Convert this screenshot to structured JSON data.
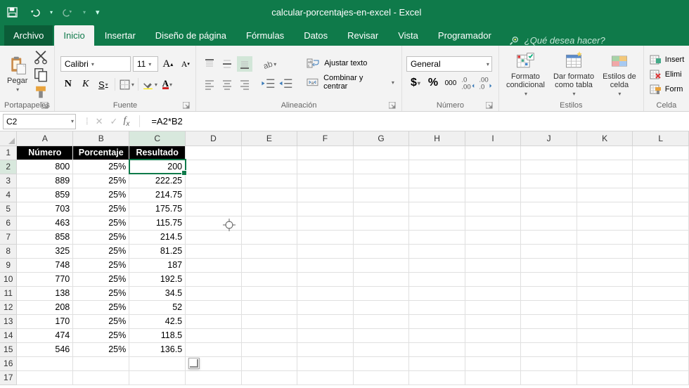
{
  "title_bar": {
    "document_title": "calcular-porcentajes-en-excel  -  Excel"
  },
  "tabs": {
    "file": "Archivo",
    "items": [
      "Inicio",
      "Insertar",
      "Diseño de página",
      "Fórmulas",
      "Datos",
      "Revisar",
      "Vista",
      "Programador"
    ],
    "active_index": 0,
    "tellme_placeholder": "¿Qué desea hacer?"
  },
  "ribbon": {
    "clipboard": {
      "label": "Portapapeles",
      "paste": "Pegar"
    },
    "font": {
      "label": "Fuente",
      "family": "Calibri",
      "size": "11",
      "bold": "N",
      "italic": "K",
      "underline": "S"
    },
    "alignment": {
      "label": "Alineación",
      "wrap": "Ajustar texto",
      "merge": "Combinar y centrar"
    },
    "number": {
      "label": "Número",
      "format": "General"
    },
    "styles": {
      "label": "Estilos",
      "conditional": "Formato\ncondicional",
      "as_table": "Dar formato\ncomo tabla",
      "cell_styles": "Estilos de\ncelda"
    },
    "cells": {
      "label": "Celda",
      "insert": "Insert",
      "delete": "Elimi",
      "format": "Form"
    }
  },
  "name_box": {
    "value": "C2"
  },
  "formula_bar": {
    "value": "=A2*B2"
  },
  "columns": [
    "A",
    "B",
    "C",
    "D",
    "E",
    "F",
    "G",
    "H",
    "I",
    "J",
    "K",
    "L"
  ],
  "active_cell": {
    "col": "C",
    "row": 2
  },
  "chart_data": {
    "type": "table",
    "headers": [
      "Número",
      "Porcentaje",
      "Resultado"
    ],
    "rows": [
      {
        "n": 1,
        "A": "Número",
        "B": "Porcentaje",
        "C": "Resultado",
        "header": true
      },
      {
        "n": 2,
        "A": "800",
        "B": "25%",
        "C": "200"
      },
      {
        "n": 3,
        "A": "889",
        "B": "25%",
        "C": "222.25"
      },
      {
        "n": 4,
        "A": "859",
        "B": "25%",
        "C": "214.75"
      },
      {
        "n": 5,
        "A": "703",
        "B": "25%",
        "C": "175.75"
      },
      {
        "n": 6,
        "A": "463",
        "B": "25%",
        "C": "115.75"
      },
      {
        "n": 7,
        "A": "858",
        "B": "25%",
        "C": "214.5"
      },
      {
        "n": 8,
        "A": "325",
        "B": "25%",
        "C": "81.25"
      },
      {
        "n": 9,
        "A": "748",
        "B": "25%",
        "C": "187"
      },
      {
        "n": 10,
        "A": "770",
        "B": "25%",
        "C": "192.5"
      },
      {
        "n": 11,
        "A": "138",
        "B": "25%",
        "C": "34.5"
      },
      {
        "n": 12,
        "A": "208",
        "B": "25%",
        "C": "52"
      },
      {
        "n": 13,
        "A": "170",
        "B": "25%",
        "C": "42.5"
      },
      {
        "n": 14,
        "A": "474",
        "B": "25%",
        "C": "118.5"
      },
      {
        "n": 15,
        "A": "546",
        "B": "25%",
        "C": "136.5"
      },
      {
        "n": 16,
        "A": "",
        "B": "",
        "C": ""
      },
      {
        "n": 17,
        "A": "",
        "B": "",
        "C": ""
      }
    ]
  }
}
